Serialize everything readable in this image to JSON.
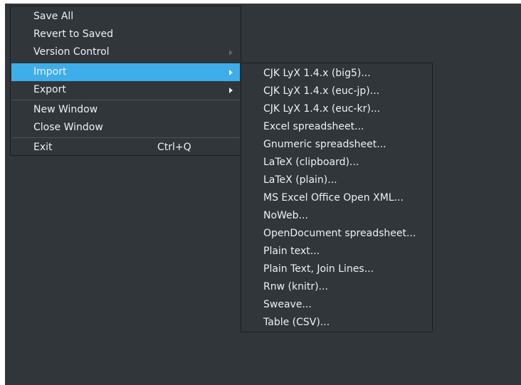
{
  "file_menu": {
    "items": [
      {
        "label": "Save All"
      },
      {
        "label": "Revert to Saved"
      },
      {
        "label": "Version Control"
      },
      {
        "label": "Import"
      },
      {
        "label": "Export"
      },
      {
        "label": "New Window"
      },
      {
        "label": "Close Window"
      },
      {
        "label": "Exit",
        "shortcut": "Ctrl+Q"
      }
    ]
  },
  "import_submenu": {
    "items": [
      "CJK LyX 1.4.x (big5)...",
      "CJK LyX 1.4.x (euc-jp)...",
      "CJK LyX 1.4.x (euc-kr)...",
      "Excel spreadsheet...",
      "Gnumeric spreadsheet...",
      "LaTeX (clipboard)...",
      "LaTeX (plain)...",
      "MS Excel Office Open XML...",
      "NoWeb...",
      "OpenDocument spreadsheet...",
      "Plain text...",
      "Plain Text, Join Lines...",
      "Rnw (knitr)...",
      "Sweave...",
      "Table (CSV)..."
    ]
  },
  "colors": {
    "background": "#31363b",
    "highlight": "#3daee9",
    "text": "#eff0f1"
  }
}
